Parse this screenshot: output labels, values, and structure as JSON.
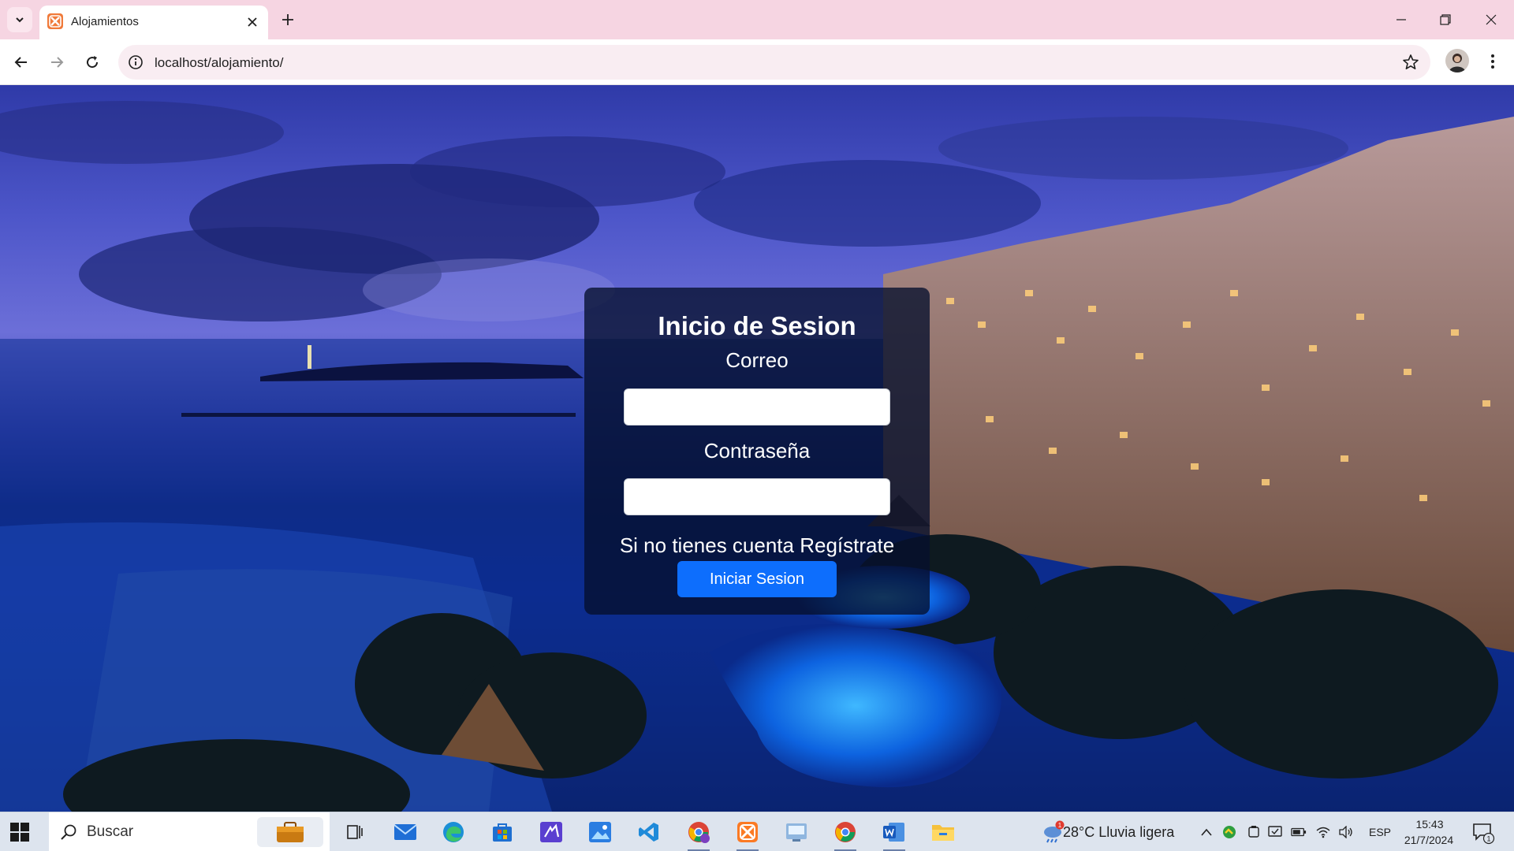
{
  "browser": {
    "tab": {
      "title": "Alojamientos",
      "favicon": "xampp-icon"
    },
    "address_bar": {
      "url": "localhost/alojamiento/"
    }
  },
  "login": {
    "title": "Inicio de Sesion",
    "email_label": "Correo",
    "email_value": "",
    "password_label": "Contraseña",
    "password_value": "",
    "register_prompt": "Si no tienes cuenta",
    "register_link": "Regístrate",
    "submit_label": "Iniciar Sesion"
  },
  "taskbar": {
    "search_placeholder": "Buscar",
    "weather": {
      "temperature": "28°C",
      "condition": "Lluvia ligera",
      "alert_count": "1"
    },
    "language": "ESP",
    "time": "15:43",
    "date": "21/7/2024",
    "notification_count": "1"
  }
}
